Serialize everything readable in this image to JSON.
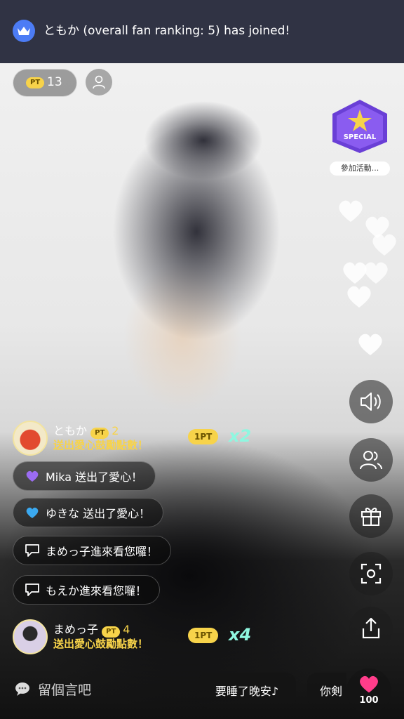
{
  "notification": {
    "text": "ともか (overall fan ranking: 5) has joined!",
    "icon": "crown-icon"
  },
  "points": {
    "badge": "PT",
    "value": "13"
  },
  "event": {
    "badge_text": "SPECIAL",
    "label": "參加活動..."
  },
  "side_buttons": [
    {
      "name": "sound-icon"
    },
    {
      "name": "viewers-icon"
    },
    {
      "name": "gift-icon"
    },
    {
      "name": "camera-icon"
    },
    {
      "name": "share-icon"
    }
  ],
  "supports": [
    {
      "name": "ともか",
      "badge": "PT",
      "count": "2",
      "action": "送出愛心鼓勵點數！",
      "pt": "1PT",
      "mult": "x2"
    },
    {
      "name": "まめっ子",
      "badge": "PT",
      "count": "4",
      "action": "送出愛心鼓勵點數！",
      "pt": "1PT",
      "mult": "x4"
    }
  ],
  "comments": [
    {
      "icon": "purple-heart-icon",
      "text": "Mika 送出了愛心！"
    },
    {
      "icon": "blue-heart-icon",
      "text": "ゆきな 送出了愛心！"
    },
    {
      "icon": "chat-icon",
      "text": "まめっ子進來看您囉！"
    },
    {
      "icon": "chat-icon",
      "text": "もえか進來看您囉！"
    }
  ],
  "input": {
    "placeholder": "留個言吧"
  },
  "quick_replies": [
    "要睡了晚安♪",
    "你剣"
  ],
  "likes": {
    "count": "100"
  },
  "colors": {
    "accent_yellow": "#f7d34a",
    "multiplier": "#8ff7e0",
    "heart": "#ff3d8a",
    "crown_bg": "#4c7cf5"
  }
}
